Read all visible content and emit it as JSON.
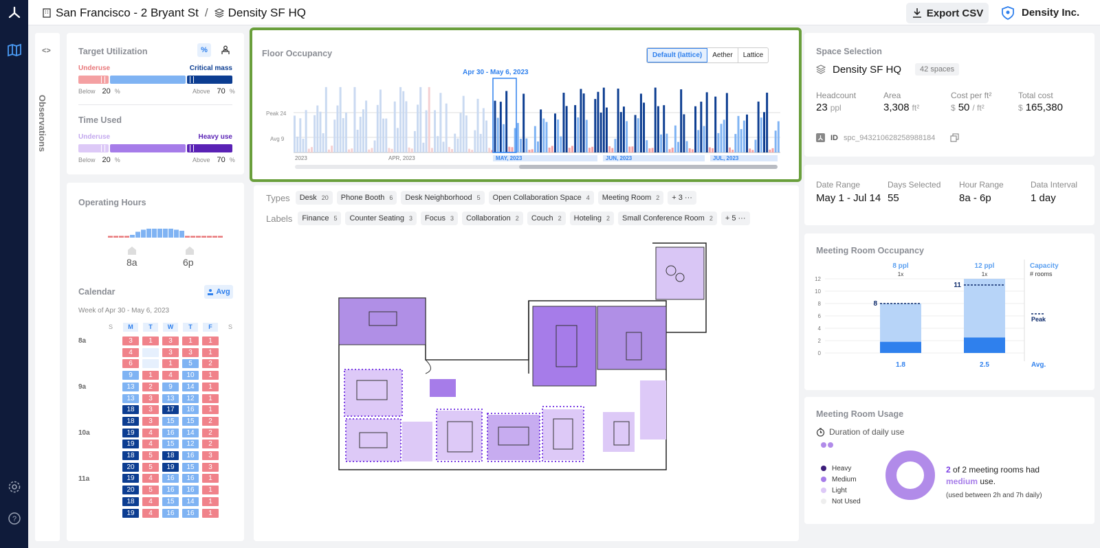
{
  "header": {
    "location": "San Francisco - 2 Bryant St",
    "separator": "/",
    "space": "Density SF HQ",
    "export_label": "Export CSV",
    "org": "Density Inc."
  },
  "observations": {
    "label": "Observations",
    "toggle": "<>"
  },
  "target_utilization": {
    "title": "Target Utilization",
    "percent_toggle": "%",
    "underuse": "Underuse",
    "critical": "Critical mass",
    "below": "Below",
    "below_val": "20",
    "above": "Above",
    "above_val": "70",
    "pct": "%"
  },
  "time_used": {
    "title": "Time Used",
    "underuse": "Underuse",
    "heavy": "Heavy use",
    "below": "Below",
    "below_val": "20",
    "above": "Above",
    "above_val": "70",
    "pct": "%"
  },
  "operating_hours": {
    "title": "Operating Hours",
    "start": "8a",
    "end": "6p",
    "bars": [
      1,
      1,
      1,
      1,
      2,
      5,
      7,
      8,
      8,
      8,
      8,
      8,
      7,
      6,
      1,
      1,
      1,
      1,
      1,
      1,
      1
    ]
  },
  "calendar": {
    "title": "Calendar",
    "avg_label": "Avg",
    "week": "Week of Apr 30 - May 6, 2023",
    "days": [
      "S",
      "M",
      "T",
      "W",
      "T",
      "F",
      "S"
    ],
    "hours": [
      "8a",
      "9a",
      "10a",
      "11a"
    ],
    "rows": [
      [
        3,
        1,
        3,
        1,
        1
      ],
      [
        4,
        "",
        3,
        3,
        1
      ],
      [
        6,
        "",
        1,
        5,
        2
      ],
      [
        9,
        1,
        4,
        10,
        1
      ],
      [
        13,
        2,
        9,
        14,
        1
      ],
      [
        13,
        3,
        13,
        12,
        1
      ],
      [
        18,
        3,
        17,
        16,
        1
      ],
      [
        18,
        3,
        15,
        15,
        2
      ],
      [
        19,
        4,
        16,
        14,
        2
      ],
      [
        19,
        4,
        15,
        12,
        2
      ],
      [
        18,
        5,
        18,
        16,
        3
      ],
      [
        20,
        5,
        19,
        15,
        3
      ],
      [
        19,
        4,
        16,
        16,
        1
      ],
      [
        20,
        5,
        16,
        16,
        1
      ],
      [
        18,
        4,
        15,
        14,
        1
      ],
      [
        19,
        4,
        16,
        16,
        1
      ]
    ]
  },
  "floor_occupancy": {
    "title": "Floor Occupancy",
    "tabs": [
      "Default (lattice)",
      "Aether",
      "Lattice"
    ],
    "range_label": "Apr 30 - May 6, 2023",
    "peak_label": "Peak 24",
    "avg_label": "Avg 9",
    "months": [
      "2023",
      "APR, 2023",
      "MAY, 2023",
      "JUN, 2023",
      "JUL, 2023"
    ]
  },
  "filters": {
    "types_label": "Types",
    "types": [
      {
        "name": "Desk",
        "count": "20"
      },
      {
        "name": "Phone Booth",
        "count": "6"
      },
      {
        "name": "Desk Neighborhood",
        "count": "5"
      },
      {
        "name": "Open Collaboration Space",
        "count": "4"
      },
      {
        "name": "Meeting Room",
        "count": "2"
      }
    ],
    "types_more": "+ 3 ···",
    "labels_label": "Labels",
    "labels": [
      {
        "name": "Finance",
        "count": "5"
      },
      {
        "name": "Counter Seating",
        "count": "3"
      },
      {
        "name": "Focus",
        "count": "3"
      },
      {
        "name": "Collaboration",
        "count": "2"
      },
      {
        "name": "Couch",
        "count": "2"
      },
      {
        "name": "Hoteling",
        "count": "2"
      },
      {
        "name": "Small Conference Room",
        "count": "2"
      }
    ],
    "labels_more": "+ 5 ···"
  },
  "space_selection": {
    "title": "Space Selection",
    "name": "Density SF HQ",
    "spaces": "42 spaces",
    "stats": [
      {
        "label": "Headcount",
        "value": "23",
        "unit": "ppl"
      },
      {
        "label": "Area",
        "value": "3,308",
        "unit": "ft²"
      },
      {
        "label": "Cost per ft²",
        "value": "50",
        "unit": "/ ft²",
        "prefix": "$"
      },
      {
        "label": "Total cost",
        "value": "165,380",
        "prefix": "$"
      }
    ],
    "id_label": "ID",
    "id_value": "spc_943210628258988184"
  },
  "date_info": [
    {
      "label": "Date Range",
      "value": "May 1 - Jul 14"
    },
    {
      "label": "Days Selected",
      "value": "55"
    },
    {
      "label": "Hour Range",
      "value": "8a - 6p"
    },
    {
      "label": "Data Interval",
      "value": "1 day"
    }
  ],
  "meeting_occupancy": {
    "title": "Meeting Room Occupancy",
    "capacity": "Capacity",
    "rooms_label": "# rooms",
    "peak": "Peak",
    "avg": "Avg.",
    "chart_data": {
      "type": "bar",
      "categories": [
        "8 ppl",
        "12 ppl"
      ],
      "counts": [
        "1x",
        "1x"
      ],
      "peak": [
        8,
        11
      ],
      "avg": [
        1.8,
        2.5
      ],
      "capacity": [
        8,
        12
      ],
      "ylim": [
        0,
        12
      ],
      "yticks": [
        0,
        2,
        4,
        6,
        8,
        10,
        12
      ]
    }
  },
  "meeting_usage": {
    "title": "Meeting Room Usage",
    "duration": "Duration of daily use",
    "legend": [
      "Heavy",
      "Medium",
      "Light",
      "Not Used"
    ],
    "count": "2",
    "sentence_a": " of 2 meeting rooms had",
    "level": "medium",
    "sentence_b": " use.",
    "note": "(used between 2h and 7h daily)"
  },
  "colors": {
    "accent": "#2f80ed",
    "purple": "#7b3fe4",
    "red": "#e8777a",
    "navy": "#0c3d91"
  }
}
